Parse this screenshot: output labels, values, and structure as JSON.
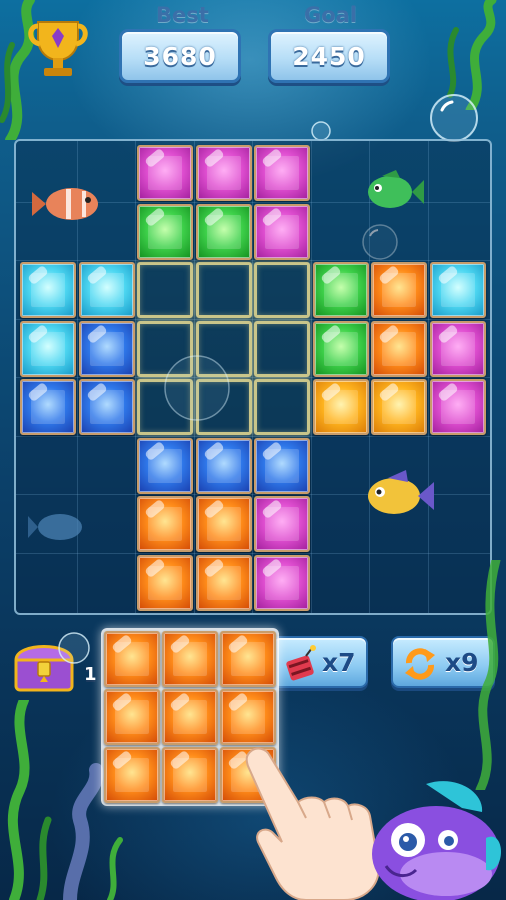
{
  "header": {
    "best_label": "Best",
    "best_value": "3680",
    "goal_label": "Goal",
    "goal_value": "2450"
  },
  "board": {
    "columns": 8,
    "rows": 8,
    "cells": [
      {
        "row": 0,
        "col": 2,
        "color": "magenta"
      },
      {
        "row": 0,
        "col": 3,
        "color": "magenta"
      },
      {
        "row": 0,
        "col": 4,
        "color": "magenta"
      },
      {
        "row": 1,
        "col": 2,
        "color": "green"
      },
      {
        "row": 1,
        "col": 3,
        "color": "green"
      },
      {
        "row": 1,
        "col": 4,
        "color": "magenta"
      },
      {
        "row": 2,
        "col": 0,
        "color": "cyan"
      },
      {
        "row": 2,
        "col": 1,
        "color": "cyan"
      },
      {
        "row": 2,
        "col": 5,
        "color": "green"
      },
      {
        "row": 2,
        "col": 6,
        "color": "orange"
      },
      {
        "row": 2,
        "col": 7,
        "color": "cyan"
      },
      {
        "row": 3,
        "col": 0,
        "color": "cyan"
      },
      {
        "row": 3,
        "col": 1,
        "color": "blue"
      },
      {
        "row": 3,
        "col": 5,
        "color": "green"
      },
      {
        "row": 3,
        "col": 6,
        "color": "orange"
      },
      {
        "row": 3,
        "col": 7,
        "color": "magenta"
      },
      {
        "row": 4,
        "col": 0,
        "color": "blue"
      },
      {
        "row": 4,
        "col": 1,
        "color": "blue"
      },
      {
        "row": 4,
        "col": 5,
        "color": "amber"
      },
      {
        "row": 4,
        "col": 6,
        "color": "amber"
      },
      {
        "row": 4,
        "col": 7,
        "color": "magenta"
      },
      {
        "row": 5,
        "col": 2,
        "color": "blue"
      },
      {
        "row": 5,
        "col": 3,
        "color": "blue"
      },
      {
        "row": 5,
        "col": 4,
        "color": "blue"
      },
      {
        "row": 6,
        "col": 2,
        "color": "orange"
      },
      {
        "row": 6,
        "col": 3,
        "color": "orange"
      },
      {
        "row": 6,
        "col": 4,
        "color": "magenta"
      },
      {
        "row": 7,
        "col": 2,
        "color": "orange"
      },
      {
        "row": 7,
        "col": 3,
        "color": "orange"
      },
      {
        "row": 7,
        "col": 4,
        "color": "magenta"
      }
    ],
    "placement_preview": [
      {
        "row": 2,
        "col": 2
      },
      {
        "row": 2,
        "col": 3
      },
      {
        "row": 2,
        "col": 4
      },
      {
        "row": 3,
        "col": 2
      },
      {
        "row": 3,
        "col": 3
      },
      {
        "row": 3,
        "col": 4
      },
      {
        "row": 4,
        "col": 2
      },
      {
        "row": 4,
        "col": 3
      },
      {
        "row": 4,
        "col": 4
      }
    ]
  },
  "dragged_piece": {
    "color": "orange",
    "rows": 3,
    "columns": 3
  },
  "boosters": {
    "chest_count": "1",
    "bomb_count": "x7",
    "refresh_count": "x9"
  },
  "colors": {
    "magenta": "#e04fd1",
    "green": "#3fd24b",
    "cyan": "#4fd8f2",
    "blue": "#2f78ea",
    "orange": "#ff8c1a",
    "amber": "#ffb41f"
  },
  "icons": [
    "trophy-icon",
    "treasure-chest-icon",
    "bomb-icon",
    "refresh-icon",
    "pointing-hand-icon",
    "fish-icon",
    "bubble-icon"
  ]
}
